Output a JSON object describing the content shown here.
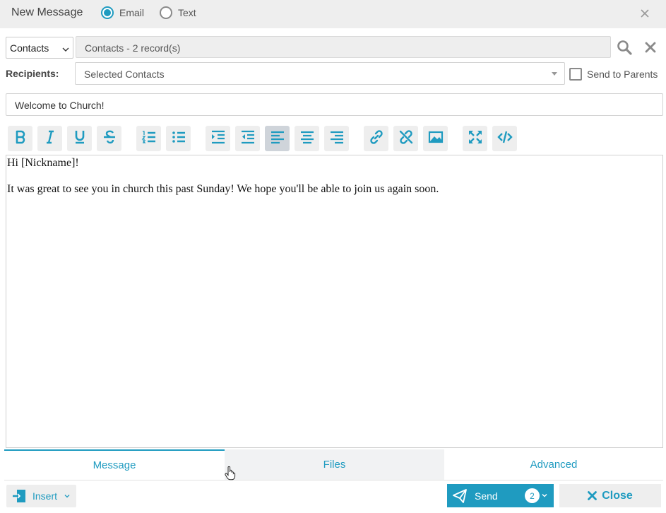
{
  "header": {
    "title": "New Message",
    "type_options": [
      {
        "label": "Email",
        "selected": true
      },
      {
        "label": "Text",
        "selected": false
      }
    ],
    "close_icon": "close-icon"
  },
  "source": {
    "select_value": "Contacts",
    "records_text": "Contacts - 2 record(s)",
    "search_icon": "search-icon",
    "clear_icon": "clear-icon"
  },
  "recipients": {
    "label": "Recipients:",
    "value": "Selected Contacts",
    "send_to_parents_label": "Send to Parents",
    "send_to_parents_checked": false
  },
  "subject": {
    "value": "Welcome to Church!"
  },
  "toolbar": {
    "buttons": [
      {
        "name": "bold",
        "icon": "bold-icon"
      },
      {
        "name": "italic",
        "icon": "italic-icon"
      },
      {
        "name": "underline",
        "icon": "underline-icon"
      },
      {
        "name": "strikethrough",
        "icon": "strikethrough-icon"
      },
      {
        "name": "ordered-list",
        "icon": "ordered-list-icon"
      },
      {
        "name": "unordered-list",
        "icon": "unordered-list-icon"
      },
      {
        "name": "indent",
        "icon": "indent-icon"
      },
      {
        "name": "outdent",
        "icon": "outdent-icon"
      },
      {
        "name": "align-left",
        "icon": "align-left-icon",
        "active": true
      },
      {
        "name": "align-center",
        "icon": "align-center-icon"
      },
      {
        "name": "align-right",
        "icon": "align-right-icon"
      },
      {
        "name": "insert-link",
        "icon": "link-icon"
      },
      {
        "name": "remove-link",
        "icon": "unlink-icon"
      },
      {
        "name": "insert-image",
        "icon": "image-icon"
      },
      {
        "name": "fullscreen",
        "icon": "fullscreen-icon"
      },
      {
        "name": "view-source",
        "icon": "code-icon"
      }
    ]
  },
  "editor": {
    "lines": [
      "Hi [Nickname]!",
      "It was great to see you in church this past Sunday! We hope you'll be able to join us again soon."
    ]
  },
  "tabs": [
    {
      "label": "Message",
      "active": true
    },
    {
      "label": "Files",
      "active": false
    },
    {
      "label": "Advanced",
      "active": false
    }
  ],
  "footer": {
    "insert_label": "Insert",
    "send_label": "Send",
    "send_count": "2",
    "close_label": "Close"
  },
  "colors": {
    "accent": "#1f9bc0",
    "header_bg": "#eeeeee",
    "toolbar_bg": "#eeeeee"
  }
}
